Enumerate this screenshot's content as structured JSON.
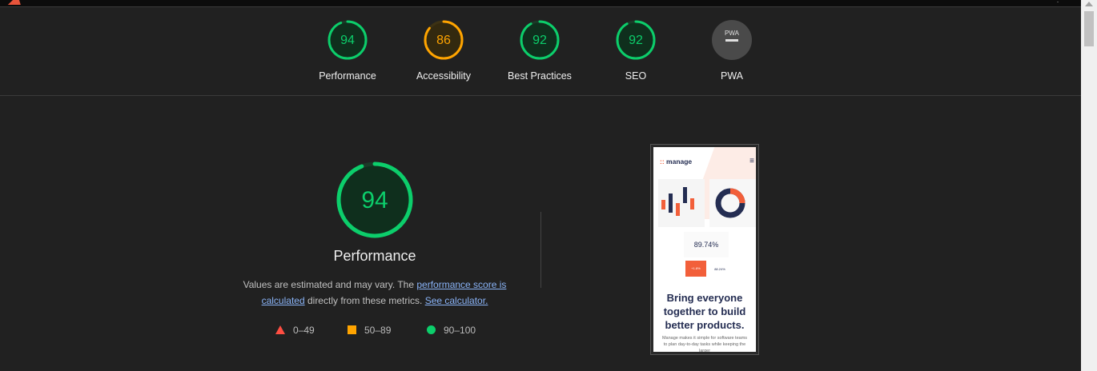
{
  "colors": {
    "pass": "#0cce6b",
    "average": "#ffa400",
    "fail": "#ff4e42",
    "na": "#9e9e9e"
  },
  "categories": [
    {
      "label": "Performance",
      "score": "94",
      "score_value": 94,
      "status": "pass"
    },
    {
      "label": "Accessibility",
      "score": "86",
      "score_value": 86,
      "status": "average"
    },
    {
      "label": "Best Practices",
      "score": "92",
      "score_value": 92,
      "status": "pass"
    },
    {
      "label": "SEO",
      "score": "92",
      "score_value": 92,
      "status": "pass"
    },
    {
      "label": "PWA",
      "score": "",
      "score_value": null,
      "status": "na",
      "badge": "PWA"
    }
  ],
  "main": {
    "score": "94",
    "score_value": 94,
    "title": "Performance",
    "desc_prefix": "Values are estimated and may vary. The ",
    "desc_link1": "performance score is calculated",
    "desc_middle": " directly from these metrics. ",
    "desc_link2": "See calculator."
  },
  "legend": [
    {
      "shape": "triangle",
      "label": "0–49"
    },
    {
      "shape": "square",
      "label": "50–89"
    },
    {
      "shape": "circle",
      "label": "90–100"
    }
  ],
  "screenshot": {
    "brand": "manage",
    "stat_main": "89.74%",
    "stat_a": "+1.8%",
    "stat_b": "88.24%",
    "headline": "Bring everyone together to build better products.",
    "subtext": "Manage makes it simple for software teams to plan day-to-day tasks while keeping the larger"
  }
}
